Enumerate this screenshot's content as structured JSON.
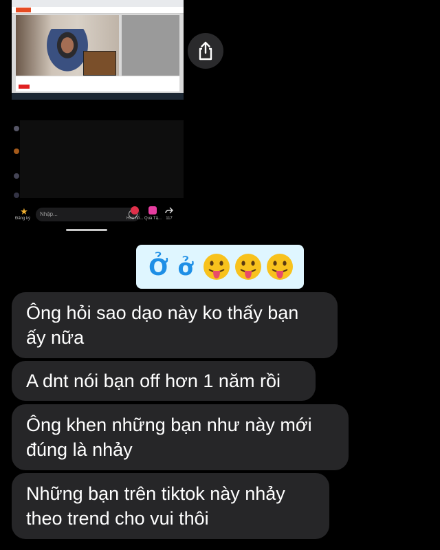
{
  "share_button": {
    "icon": "share-icon"
  },
  "stream": {
    "subscribe_label": "Đăng ký",
    "chat_placeholder": "Nhập...",
    "actions": [
      {
        "label": "Hoa hồ...",
        "icon": "rose-icon",
        "color": "#e0304a"
      },
      {
        "label": "Quà Tặ...",
        "icon": "gift-icon",
        "color": "#e63da0"
      },
      {
        "label": "117",
        "icon": "share-arrow-icon",
        "color": "#dddddd"
      }
    ]
  },
  "reaction": {
    "text": "Ở ở",
    "emoji": "face-with-tongue",
    "emoji_count": 3
  },
  "messages": [
    {
      "line1": "Ông hỏi sao dạo này ko thấy bạn",
      "line2": "ấy nữa"
    },
    {
      "line1": "A dnt nói bạn off hơn 1 năm rồi",
      "line2": ""
    },
    {
      "line1": "Ông khen những bạn như này mới",
      "line2": "đúng là nhảy"
    },
    {
      "line1": "Những bạn trên tiktok này nhảy",
      "line2": "theo trend cho vui thôi"
    }
  ],
  "colors": {
    "background": "#000000",
    "bubble": "#262628",
    "reaction_bg": "#dff6ff",
    "reaction_text": "#1e8fe6"
  }
}
